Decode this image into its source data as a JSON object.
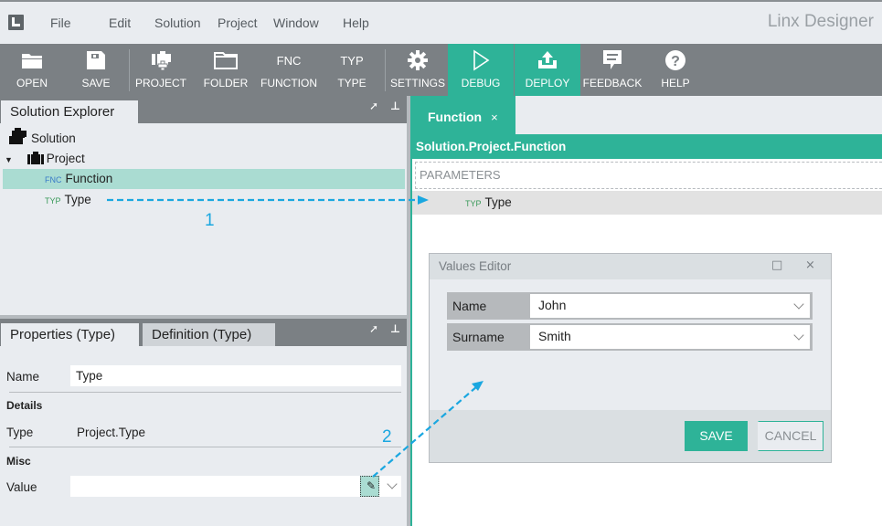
{
  "app": {
    "title": "Linx Designer",
    "logo_icon": "linx-logo-icon"
  },
  "menu": {
    "items": [
      {
        "label": "File"
      },
      {
        "label": "Edit"
      },
      {
        "label": "Solution"
      },
      {
        "label": "Project"
      },
      {
        "label": "Window"
      },
      {
        "label": "Help"
      }
    ]
  },
  "toolbar": {
    "buttons": [
      {
        "label": "OPEN",
        "icon": "folder-open-icon"
      },
      {
        "label": "SAVE",
        "icon": "floppy-icon"
      },
      {
        "label": "PROJECT",
        "icon": "add-project-icon"
      },
      {
        "label": "FOLDER",
        "icon": "folder-icon"
      },
      {
        "label": "FUNCTION",
        "icon_text": "FNC"
      },
      {
        "label": "TYPE",
        "icon_text": "TYP"
      },
      {
        "label": "SETTINGS",
        "icon": "gear-icon"
      },
      {
        "label": "DEBUG",
        "icon": "play-icon",
        "active": true
      },
      {
        "label": "DEPLOY",
        "icon": "upload-icon",
        "active": true
      },
      {
        "label": "FEEDBACK",
        "icon": "speech-bubble-icon"
      },
      {
        "label": "HELP",
        "icon": "question-circle-icon"
      }
    ],
    "accent_color": "#2eb398"
  },
  "solution_explorer": {
    "tab_label": "Solution Explorer",
    "tree": [
      {
        "label": "Solution",
        "level": 0
      },
      {
        "label": "Project",
        "level": 1,
        "expanded": true
      },
      {
        "label": "Function",
        "badge": "FNC",
        "level": 2,
        "selected": true
      },
      {
        "label": "Type",
        "badge": "TYP",
        "level": 2
      }
    ]
  },
  "properties": {
    "tabs": [
      {
        "label": "Properties (Type)",
        "active": true
      },
      {
        "label": "Definition (Type)",
        "active": false
      }
    ],
    "name_label": "Name",
    "name_value": "Type",
    "details_section": "Details",
    "type_label": "Type",
    "type_value": "Project.Type",
    "misc_section": "Misc",
    "value_label": "Value",
    "value_value": ""
  },
  "editor": {
    "tab_label": "Function",
    "tab_close": "×",
    "path": "Solution.Project.Function",
    "parameters_label": "PARAMETERS",
    "parameter": {
      "badge": "TYP",
      "label": "Type"
    }
  },
  "values_editor": {
    "title": "Values Editor",
    "maximize": "□",
    "close": "×",
    "fields": [
      {
        "label": "Name",
        "value": "John"
      },
      {
        "label": "Surname",
        "value": "Smith"
      }
    ],
    "save_label": "SAVE",
    "cancel_label": "CANCEL"
  },
  "annotations": {
    "step1": "1",
    "step2": "2",
    "color": "#1aa7e0"
  }
}
